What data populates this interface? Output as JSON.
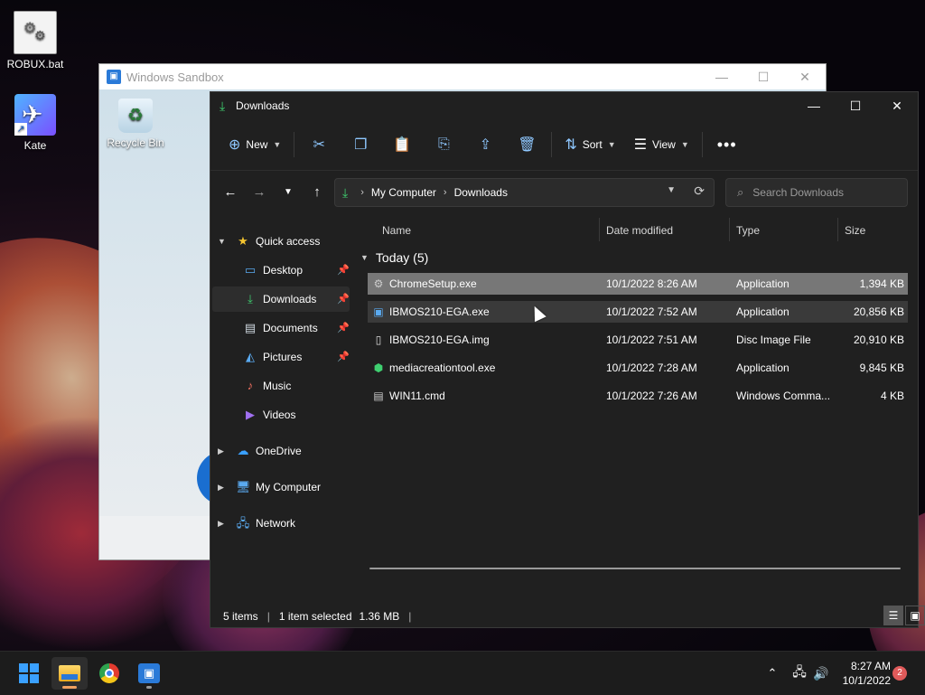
{
  "desktop": {
    "icons": [
      {
        "label": "ROBUX.bat"
      },
      {
        "label": "Kate"
      }
    ]
  },
  "sandbox": {
    "title": "Windows Sandbox",
    "recycle_label": "Recycle Bin"
  },
  "explorer": {
    "title": "Downloads",
    "toolbar": {
      "new_label": "New",
      "sort_label": "Sort",
      "view_label": "View",
      "more_label": "•••"
    },
    "address": {
      "crumbs": [
        "My Computer",
        "Downloads"
      ]
    },
    "search": {
      "placeholder": "Search Downloads"
    },
    "sidebar": {
      "quick_access": "Quick access",
      "items": [
        {
          "label": "Desktop",
          "pinned": true
        },
        {
          "label": "Downloads",
          "pinned": true,
          "selected": true
        },
        {
          "label": "Documents",
          "pinned": true
        },
        {
          "label": "Pictures",
          "pinned": true
        },
        {
          "label": "Music",
          "pinned": false
        },
        {
          "label": "Videos",
          "pinned": false
        }
      ],
      "roots": [
        "OneDrive",
        "My Computer",
        "Network"
      ]
    },
    "columns": [
      "Name",
      "Date modified",
      "Type",
      "Size"
    ],
    "group_label": "Today (5)",
    "files": [
      {
        "name": "ChromeSetup.exe",
        "date": "10/1/2022 8:26 AM",
        "type": "Application",
        "size": "1,394 KB",
        "state": "selected"
      },
      {
        "name": "IBMOS210-EGA.exe",
        "date": "10/1/2022 7:52 AM",
        "type": "Application",
        "size": "20,856 KB",
        "state": "hover"
      },
      {
        "name": "IBMOS210-EGA.img",
        "date": "10/1/2022 7:51 AM",
        "type": "Disc Image File",
        "size": "20,910 KB",
        "state": ""
      },
      {
        "name": "mediacreationtool.exe",
        "date": "10/1/2022 7:28 AM",
        "type": "Application",
        "size": "9,845 KB",
        "state": ""
      },
      {
        "name": "WIN11.cmd",
        "date": "10/1/2022 7:26 AM",
        "type": "Windows Comma...",
        "size": "4 KB",
        "state": ""
      }
    ],
    "status": {
      "items": "5 items",
      "selected": "1 item selected",
      "size": "1.36 MB"
    }
  },
  "taskbar": {
    "time": "8:27 AM",
    "date": "10/1/2022",
    "notifications": "2"
  }
}
